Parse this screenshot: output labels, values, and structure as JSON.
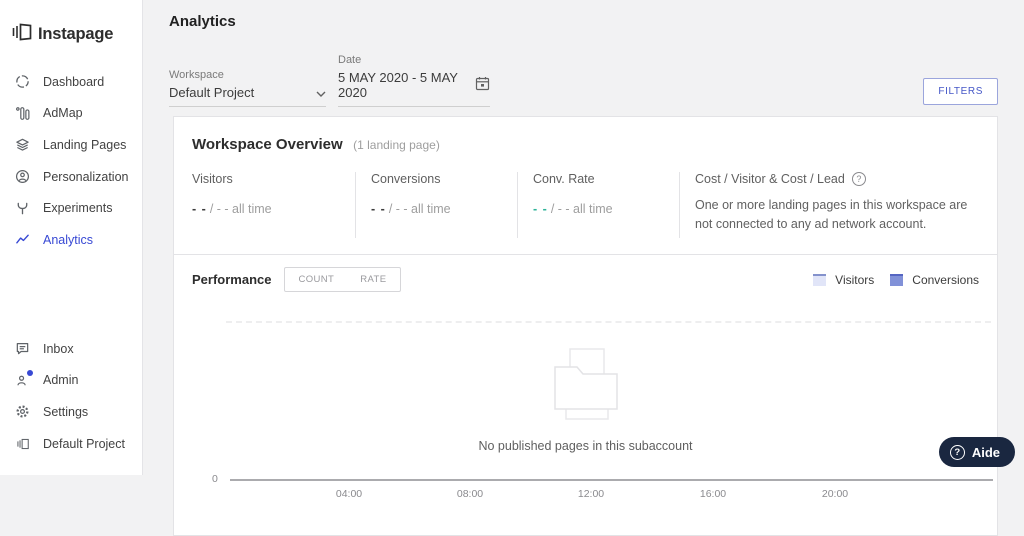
{
  "app": {
    "name": "Instapage"
  },
  "sidebar": {
    "items": [
      {
        "label": "Dashboard"
      },
      {
        "label": "AdMap"
      },
      {
        "label": "Landing Pages"
      },
      {
        "label": "Personalization"
      },
      {
        "label": "Experiments"
      },
      {
        "label": "Analytics",
        "active": true
      }
    ],
    "bottom_items": [
      {
        "label": "Inbox"
      },
      {
        "label": "Admin",
        "has_notification_dot": true
      },
      {
        "label": "Settings"
      },
      {
        "label": "Default Project"
      }
    ]
  },
  "header": {
    "title": "Analytics"
  },
  "toolbar": {
    "workspace_label": "Workspace",
    "workspace_value": "Default Project",
    "date_label": "Date",
    "date_value": "5 MAY 2020 - 5 MAY 2020",
    "filters_button": "FILTERS"
  },
  "overview": {
    "title": "Workspace Overview",
    "subtitle": "(1 landing page)",
    "stats": [
      {
        "label": "Visitors",
        "value": "- -",
        "suffix": "/ - - all time",
        "value_color": "#3c3c3c"
      },
      {
        "label": "Conversions",
        "value": "- -",
        "suffix": "/ - - all time",
        "value_color": "#3c3c3c"
      },
      {
        "label": "Conv. Rate",
        "value": "- -",
        "suffix": "/ - - all time",
        "value_color": "#2eb398"
      }
    ],
    "cost": {
      "label": "Cost / Visitor & Cost / Lead",
      "message": "One or more landing pages in this workspace are not connected to any ad network account."
    }
  },
  "performance": {
    "title": "Performance",
    "toggle": [
      {
        "label": "COUNT"
      },
      {
        "label": "RATE"
      }
    ],
    "legend": [
      {
        "label": "Visitors",
        "fill": "#e1e5f8",
        "border": "#8492cc"
      },
      {
        "label": "Conversions",
        "fill": "#8191d8",
        "border": "#5565c2"
      }
    ]
  },
  "chart_data": {
    "type": "line",
    "title": "Performance",
    "x_ticks": [
      "04:00",
      "08:00",
      "12:00",
      "16:00",
      "20:00"
    ],
    "y_origin_label": "0",
    "series": [
      {
        "name": "Visitors",
        "values": []
      },
      {
        "name": "Conversions",
        "values": []
      }
    ],
    "empty_state_message": "No published pages in this subaccount",
    "legend_position": "top-right",
    "grid": "single dashed horizontal gridline at top of plot area"
  },
  "colors": {
    "accent": "#3849d4",
    "conv_rate_teal": "#2eb398",
    "filters_text": "#4456c7",
    "help_button_bg": "#1a2740"
  },
  "help_button": {
    "label": "Aide"
  }
}
